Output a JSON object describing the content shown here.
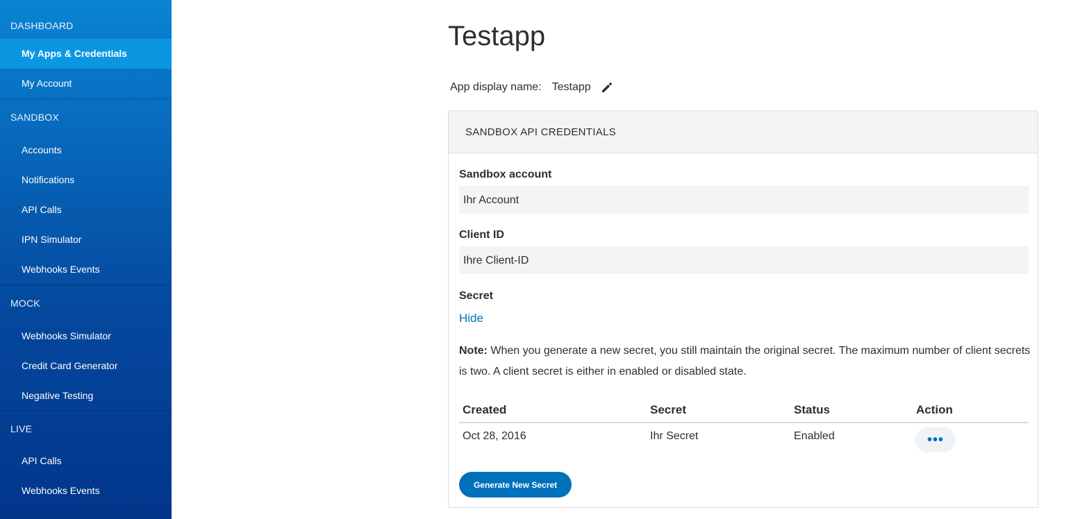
{
  "sidebar": {
    "sections": [
      {
        "title": "DASHBOARD",
        "items": [
          "My Apps & Credentials",
          "My Account"
        ]
      },
      {
        "title": "SANDBOX",
        "items": [
          "Accounts",
          "Notifications",
          "API Calls",
          "IPN Simulator",
          "Webhooks Events"
        ]
      },
      {
        "title": "MOCK",
        "items": [
          "Webhooks Simulator",
          "Credit Card Generator",
          "Negative Testing"
        ]
      },
      {
        "title": "LIVE",
        "items": [
          "API Calls",
          "Webhooks Events"
        ]
      }
    ],
    "active_item": "My Apps & Credentials"
  },
  "page": {
    "title": "Testapp",
    "display_name_label": "App display name:",
    "display_name_value": "Testapp"
  },
  "card": {
    "header": "SANDBOX API CREDENTIALS",
    "sandbox_account_label": "Sandbox account",
    "sandbox_account_value": "Ihr Account",
    "client_id_label": "Client ID",
    "client_id_value": "Ihre Client-ID",
    "secret_label": "Secret",
    "secret_toggle": "Hide",
    "note_prefix": "Note:",
    "note_text": " When you generate a new secret, you still maintain the original secret. The maximum number of client secrets is two. A client secret is either in enabled or disabled state.",
    "table": {
      "headers": [
        "Created",
        "Secret",
        "Status",
        "Action"
      ],
      "rows": [
        {
          "created": "Oct 28, 2016",
          "secret": "Ihr Secret",
          "status": "Enabled",
          "action": "•••"
        }
      ]
    },
    "generate_button": "Generate New Secret"
  },
  "colors": {
    "accent": "#0070ba",
    "sidebar_active": "#0b96e2"
  }
}
